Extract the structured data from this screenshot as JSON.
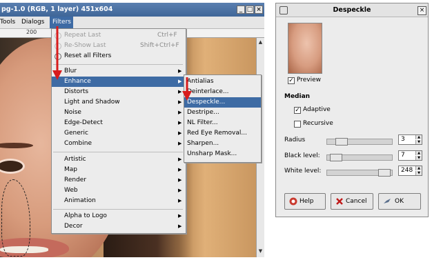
{
  "image_window": {
    "title": "pg-1.0 (RGB, 1 layer) 451x604",
    "menubar": [
      "Tools",
      "Dialogs",
      "Filters"
    ],
    "ruler_label": "200"
  },
  "filters_menu": {
    "top_items": [
      {
        "label": "Repeat Last",
        "shortcut": "Ctrl+F",
        "disabled": true
      },
      {
        "label": "Re-Show Last",
        "shortcut": "Shift+Ctrl+F",
        "disabled": true
      },
      {
        "label": "Reset all Filters",
        "shortcut": "",
        "disabled": false
      }
    ],
    "group1": [
      "Blur",
      "Enhance",
      "Distorts",
      "Light and Shadow",
      "Noise",
      "Edge-Detect",
      "Generic",
      "Combine"
    ],
    "group2": [
      "Artistic",
      "Map",
      "Render",
      "Web",
      "Animation"
    ],
    "group3": [
      "Alpha to Logo",
      "Decor"
    ],
    "highlighted": "Enhance"
  },
  "enhance_submenu": {
    "items": [
      "Antialias",
      "Deinterlace...",
      "Despeckle...",
      "Destripe...",
      "NL Filter...",
      "Red Eye Removal...",
      "Sharpen...",
      "Unsharp Mask..."
    ],
    "highlighted": "Despeckle..."
  },
  "despeckle_dialog": {
    "title": "Despeckle",
    "preview_label": "Preview",
    "preview_checked": true,
    "median_heading": "Median",
    "adaptive_label": "Adaptive",
    "adaptive_checked": true,
    "recursive_label": "Recursive",
    "recursive_checked": false,
    "radius_label": "Radius",
    "radius_value": "3",
    "black_level_label": "Black level:",
    "black_level_value": "7",
    "white_level_label": "White level:",
    "white_level_value": "248",
    "buttons": {
      "help": "Help",
      "cancel": "Cancel",
      "ok": "OK"
    }
  },
  "colors": {
    "highlight": "#3e6ba4",
    "arrow": "#d81c1c",
    "titlebar": "#4a70a3"
  }
}
